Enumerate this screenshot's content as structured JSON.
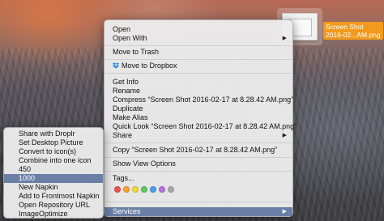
{
  "desktop": {
    "file_name_lines": [
      "Screen Shot",
      "2016-02...AM.png"
    ]
  },
  "context_menu": {
    "items": [
      {
        "label": "Open"
      },
      {
        "label": "Open With"
      },
      {
        "label": "Move to Trash"
      },
      {
        "label": "Move to Dropbox"
      },
      {
        "label": "Get Info"
      },
      {
        "label": "Rename"
      },
      {
        "label": "Compress “Screen Shot 2016-02-17 at 8.28.42 AM.png”"
      },
      {
        "label": "Duplicate"
      },
      {
        "label": "Make Alias"
      },
      {
        "label": "Quick Look “Screen Shot 2016-02-17 at 8.28.42 AM.png”"
      },
      {
        "label": "Share"
      },
      {
        "label": "Copy “Screen Shot 2016-02-17 at 8.28.42 AM.png”"
      },
      {
        "label": "Show View Options"
      },
      {
        "label": "Tags..."
      },
      {
        "label": "Services"
      }
    ],
    "submenu_arrow": "▶",
    "tag_colors": [
      "#f0524f",
      "#f6a330",
      "#f4d53a",
      "#60c85a",
      "#4d9cf0",
      "#b675e0",
      "#a9a9a9"
    ]
  },
  "services_menu": {
    "items": [
      {
        "label": "Share with Droplr"
      },
      {
        "label": "Set Desktop Picture"
      },
      {
        "label": "Convert to icon(s)"
      },
      {
        "label": "Combine into one icon"
      },
      {
        "label": "450"
      },
      {
        "label": "1000"
      },
      {
        "label": "New Napkin"
      },
      {
        "label": "Add to Frontmost Napkin"
      },
      {
        "label": "Open Repository URL"
      },
      {
        "label": "ImageOptimize"
      }
    ]
  },
  "highlight_color": "#6a7ea6",
  "file_label_color": "#f29a1d"
}
